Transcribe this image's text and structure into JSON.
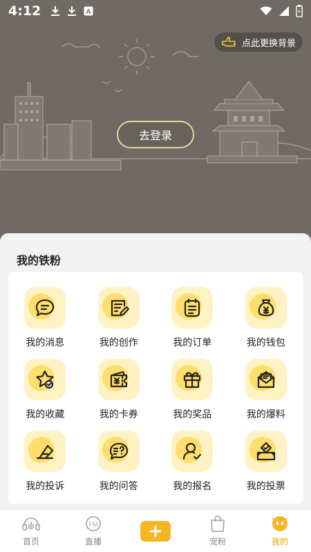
{
  "status_bar": {
    "time": "4:12",
    "left_icons": [
      "download-icon",
      "download-icon",
      "app-a-icon"
    ],
    "right_icons": [
      "wifi-icon",
      "signal-icon",
      "battery-icon"
    ]
  },
  "hero": {
    "background_toggle_label": "点此更换背景",
    "login_label": "去登录"
  },
  "section": {
    "title": "我的铁粉",
    "items": [
      {
        "label": "我的消息",
        "icon": "message-icon"
      },
      {
        "label": "我的创作",
        "icon": "edit-note-icon"
      },
      {
        "label": "我的订单",
        "icon": "order-list-icon"
      },
      {
        "label": "我的钱包",
        "icon": "money-bag-icon"
      },
      {
        "label": "我的收藏",
        "icon": "star-check-icon"
      },
      {
        "label": "我的卡券",
        "icon": "coupon-icon"
      },
      {
        "label": "我的奖品",
        "icon": "gift-icon"
      },
      {
        "label": "我的爆料",
        "icon": "envelope-icon"
      },
      {
        "label": "我的投诉",
        "icon": "complaint-icon"
      },
      {
        "label": "我的问答",
        "icon": "question-chat-icon"
      },
      {
        "label": "我的报名",
        "icon": "user-check-icon"
      },
      {
        "label": "我的投票",
        "icon": "ballot-box-icon"
      }
    ]
  },
  "bottom_nav": {
    "items": [
      {
        "label": "首页",
        "icon": "home-headset-icon"
      },
      {
        "label": "直播",
        "icon": "fm-radio-icon"
      },
      {
        "label": "",
        "icon": "plus-icon"
      },
      {
        "label": "宠粉",
        "icon": "shopping-bag-icon"
      },
      {
        "label": "我的",
        "icon": "profile-face-icon",
        "active": true
      }
    ]
  },
  "colors": {
    "hero_bg": "#6f6b64",
    "accent": "#f5b622",
    "tile_bg": "#fff3c4",
    "tile_circle": "#ffd95c",
    "active_tab": "#e6a100"
  }
}
